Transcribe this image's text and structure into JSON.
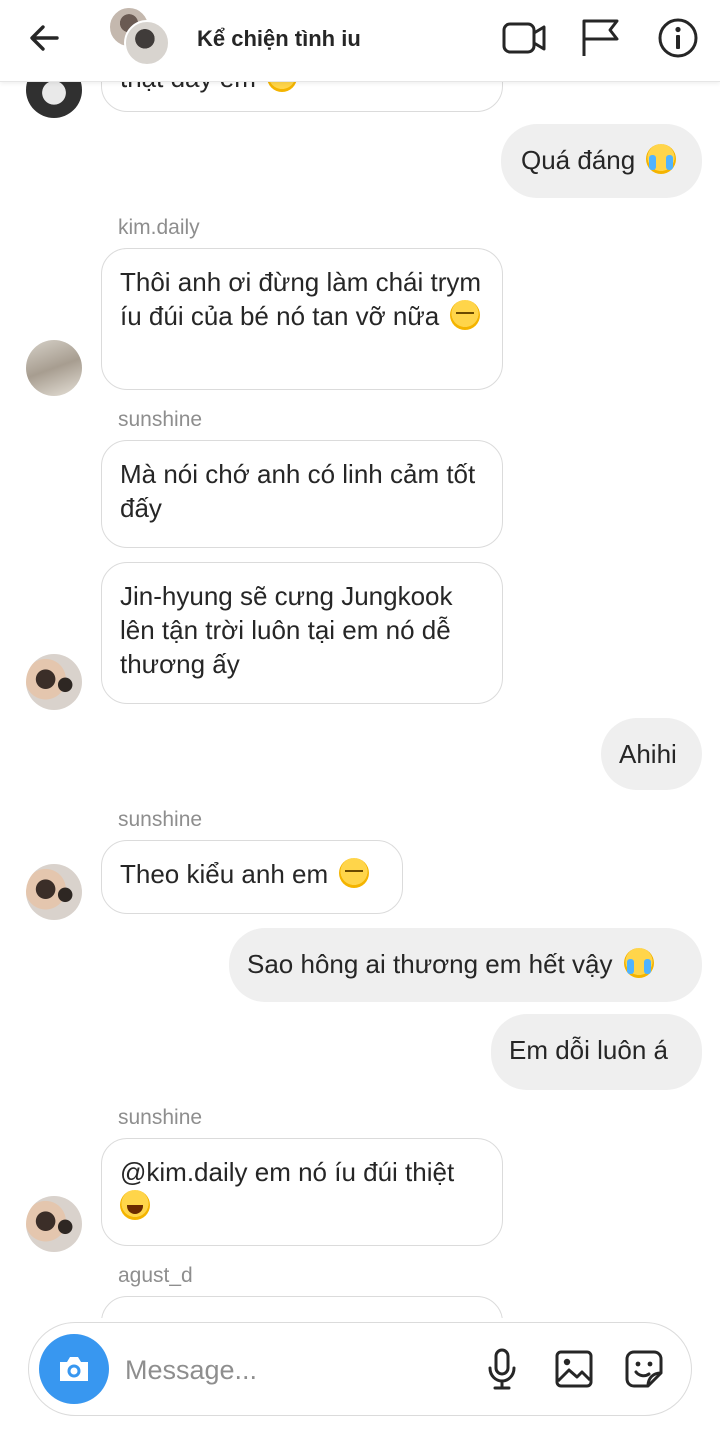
{
  "header": {
    "title": "Kể chiện tình iu"
  },
  "messages": {
    "m0_partial": "thật đấy em",
    "m1": "Quá đáng",
    "s1": "kim.daily",
    "m2": "Thôi anh ơi đừng làm chái trym íu đúi của bé nó tan vỡ nữa",
    "s2": "sunshine",
    "m3": "Mà nói chớ anh có linh cảm tốt đấy",
    "m4": "Jin-hyung sẽ cưng Jungkook lên tận trời luôn tại em nó dễ thương ấy",
    "m5": "Ahihi",
    "s3": "sunshine",
    "m6": "Theo kiểu anh em",
    "m7": "Sao hông ai thương em hết vậy",
    "m8": "Em dỗi luôn á",
    "s4": "sunshine",
    "m9": "@kim.daily em nó íu đúi thiệt",
    "s5": "agust_d"
  },
  "composer": {
    "placeholder": "Message..."
  },
  "icons": [
    "back-arrow-icon",
    "video-call-icon",
    "flag-icon",
    "info-icon",
    "camera-icon",
    "microphone-icon",
    "gallery-icon",
    "sticker-icon"
  ],
  "colors": {
    "accent": "#3897f0",
    "incoming_bubble_border": "#dbdbdb",
    "outgoing_bubble_bg": "#efefef",
    "sender_name": "#8e8e8e"
  }
}
